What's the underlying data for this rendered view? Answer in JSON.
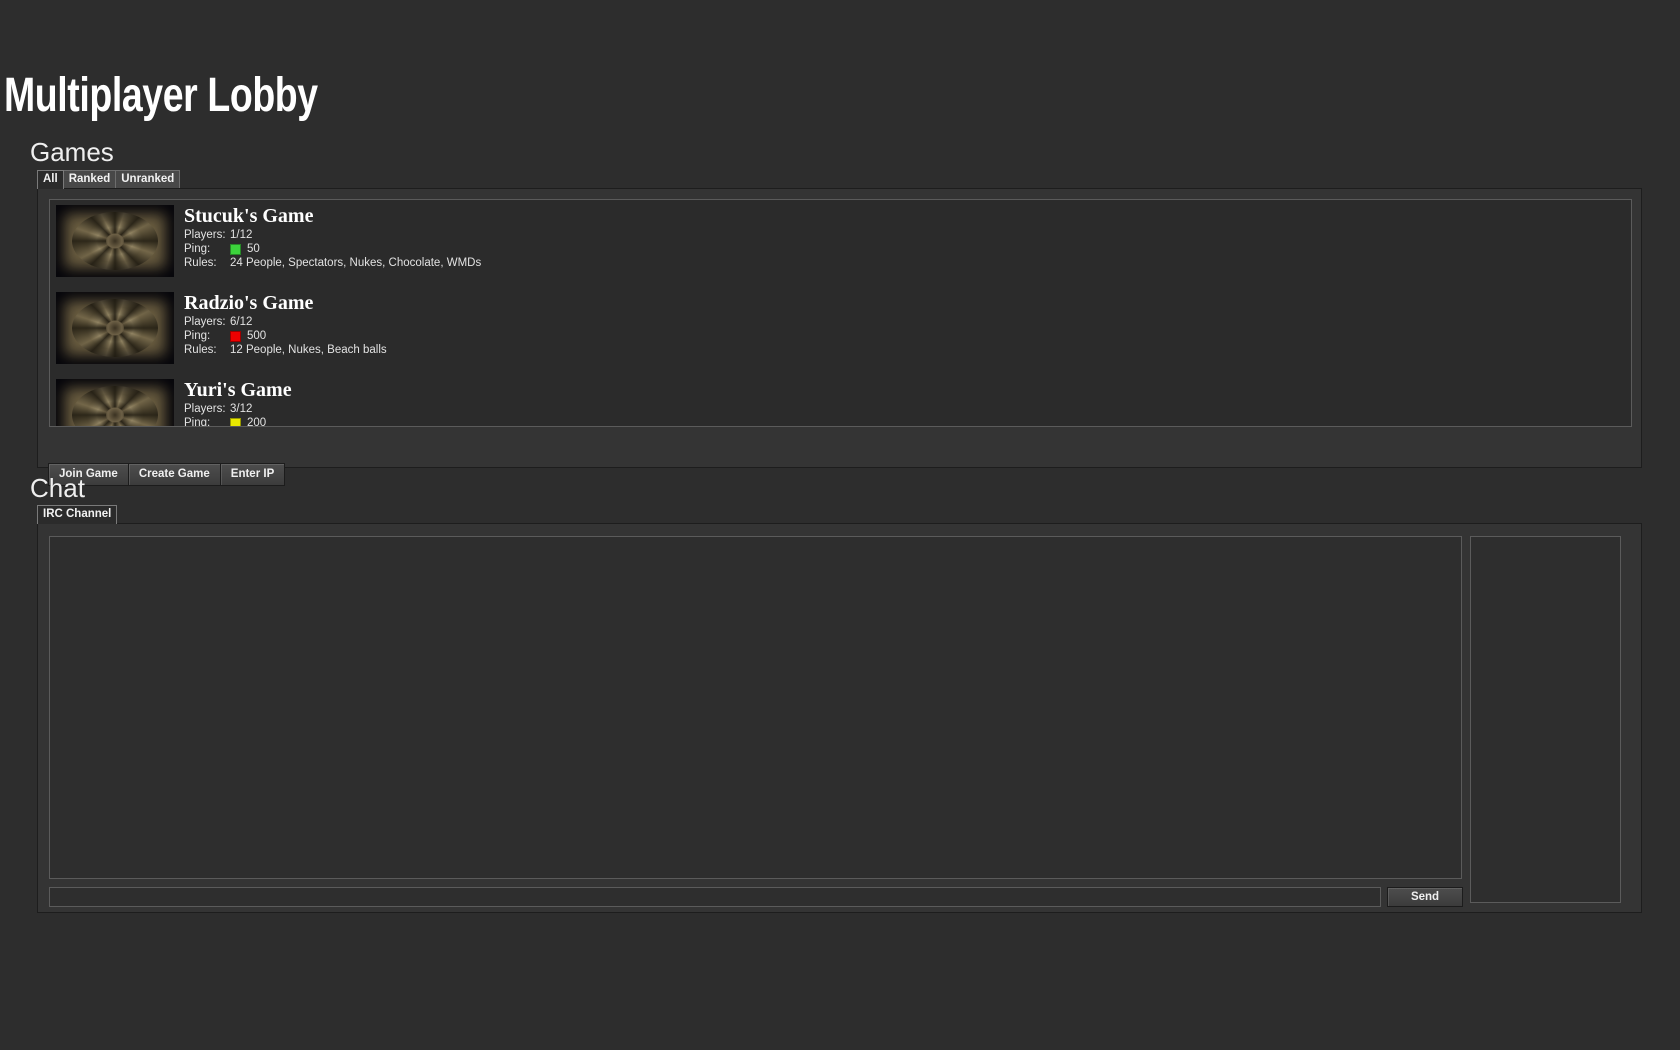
{
  "app": {
    "title": "Multiplayer Lobby"
  },
  "games_section": {
    "heading": "Games",
    "tabs": [
      {
        "label": "All",
        "active": true
      },
      {
        "label": "Ranked",
        "active": false
      },
      {
        "label": "Unranked",
        "active": false
      }
    ],
    "labels": {
      "players": "Players:",
      "ping": "Ping:",
      "rules": "Rules:"
    },
    "games": [
      {
        "title": "Stucuk's Game",
        "players": "1/12",
        "ping": "50",
        "ping_color": "#3cd33c",
        "rules": "24 People, Spectators, Nukes, Chocolate, WMDs",
        "map_thumbnail": "map-thumbnail"
      },
      {
        "title": "Radzio's Game",
        "players": "6/12",
        "ping": "500",
        "ping_color": "#ee0000",
        "rules": "12 People, Nukes, Beach balls",
        "map_thumbnail": "map-thumbnail"
      },
      {
        "title": "Yuri's Game",
        "players": "3/12",
        "ping": "200",
        "ping_color": "#e8e800",
        "rules": "",
        "map_thumbnail": "map-thumbnail"
      }
    ],
    "buttons": [
      {
        "label": "Join Game"
      },
      {
        "label": "Create Game"
      },
      {
        "label": "Enter IP"
      }
    ]
  },
  "chat_section": {
    "heading": "Chat",
    "tabs": [
      {
        "label": "IRC Channel",
        "active": true
      }
    ],
    "log_text": "",
    "users": [],
    "input_value": "",
    "input_placeholder": "",
    "send_label": "Send"
  },
  "colors": {
    "background": "#2d2d2d",
    "panel": "#343434",
    "panel_border": "#1d1d1d",
    "list_background": "#2b2b2b",
    "list_border": "#5b5b5b",
    "tab_active": "#2b2b2b",
    "tab_inactive": "#484848",
    "text": "#e8e8e8"
  }
}
